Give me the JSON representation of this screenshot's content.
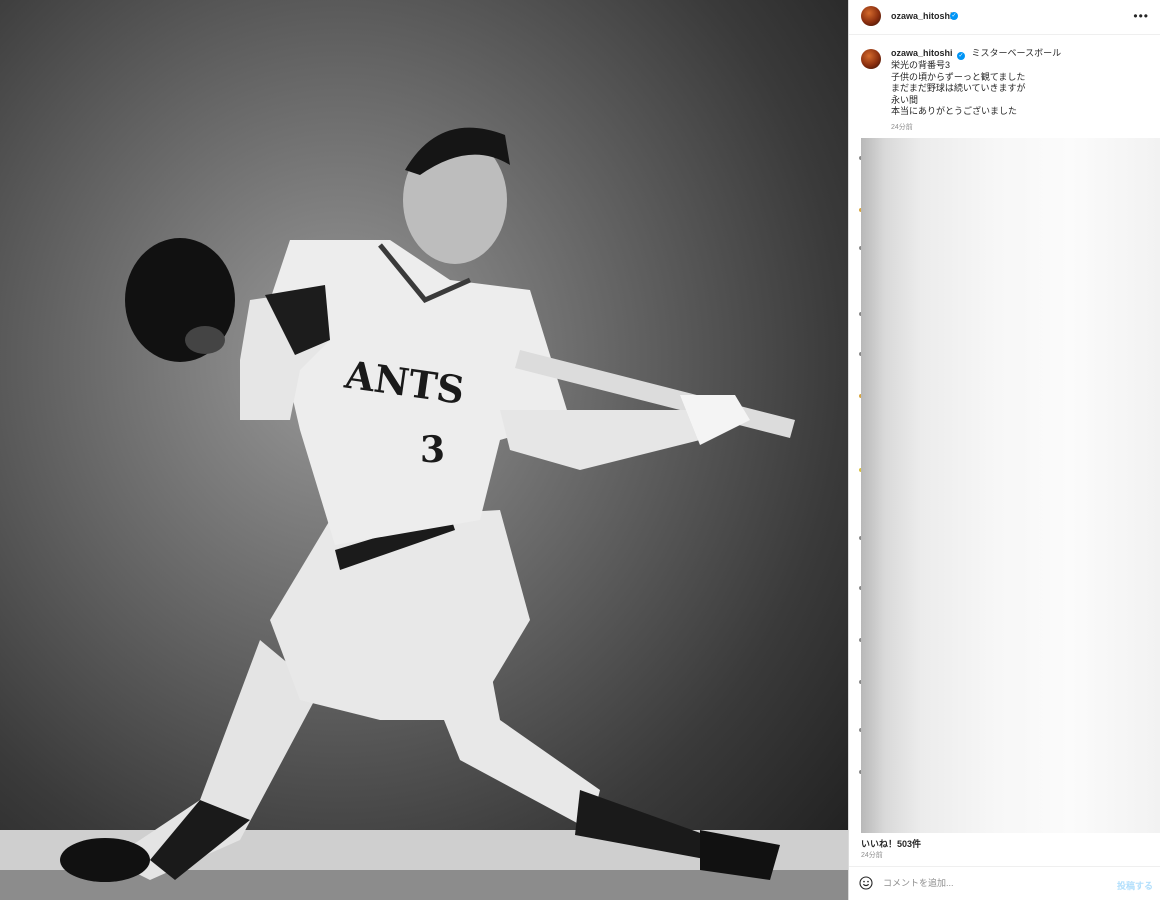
{
  "photo": {
    "jersey_text": "ANTS",
    "jersey_number": "3"
  },
  "header": {
    "username": "ozawa_hitoshi",
    "more_icon": "more-horizontal-icon"
  },
  "caption": {
    "username": "ozawa_hitoshi",
    "lines": [
      "ミスターベースボール",
      "栄光の背番号3",
      "子供の頃からずーっと観てました",
      "まだまだ野球は続いていきますが",
      "永い間",
      "本当にありがとうございました"
    ],
    "timestamp": "24分前"
  },
  "footer": {
    "likes": "いいね！503件",
    "timestamp": "24分前"
  },
  "comment": {
    "placeholder": "コメントを追加...",
    "post_label": "投稿する",
    "emoji_icon": "smiley-icon"
  },
  "colors": {
    "verified": "#0095f6",
    "post_disabled": "#b2dffc"
  }
}
